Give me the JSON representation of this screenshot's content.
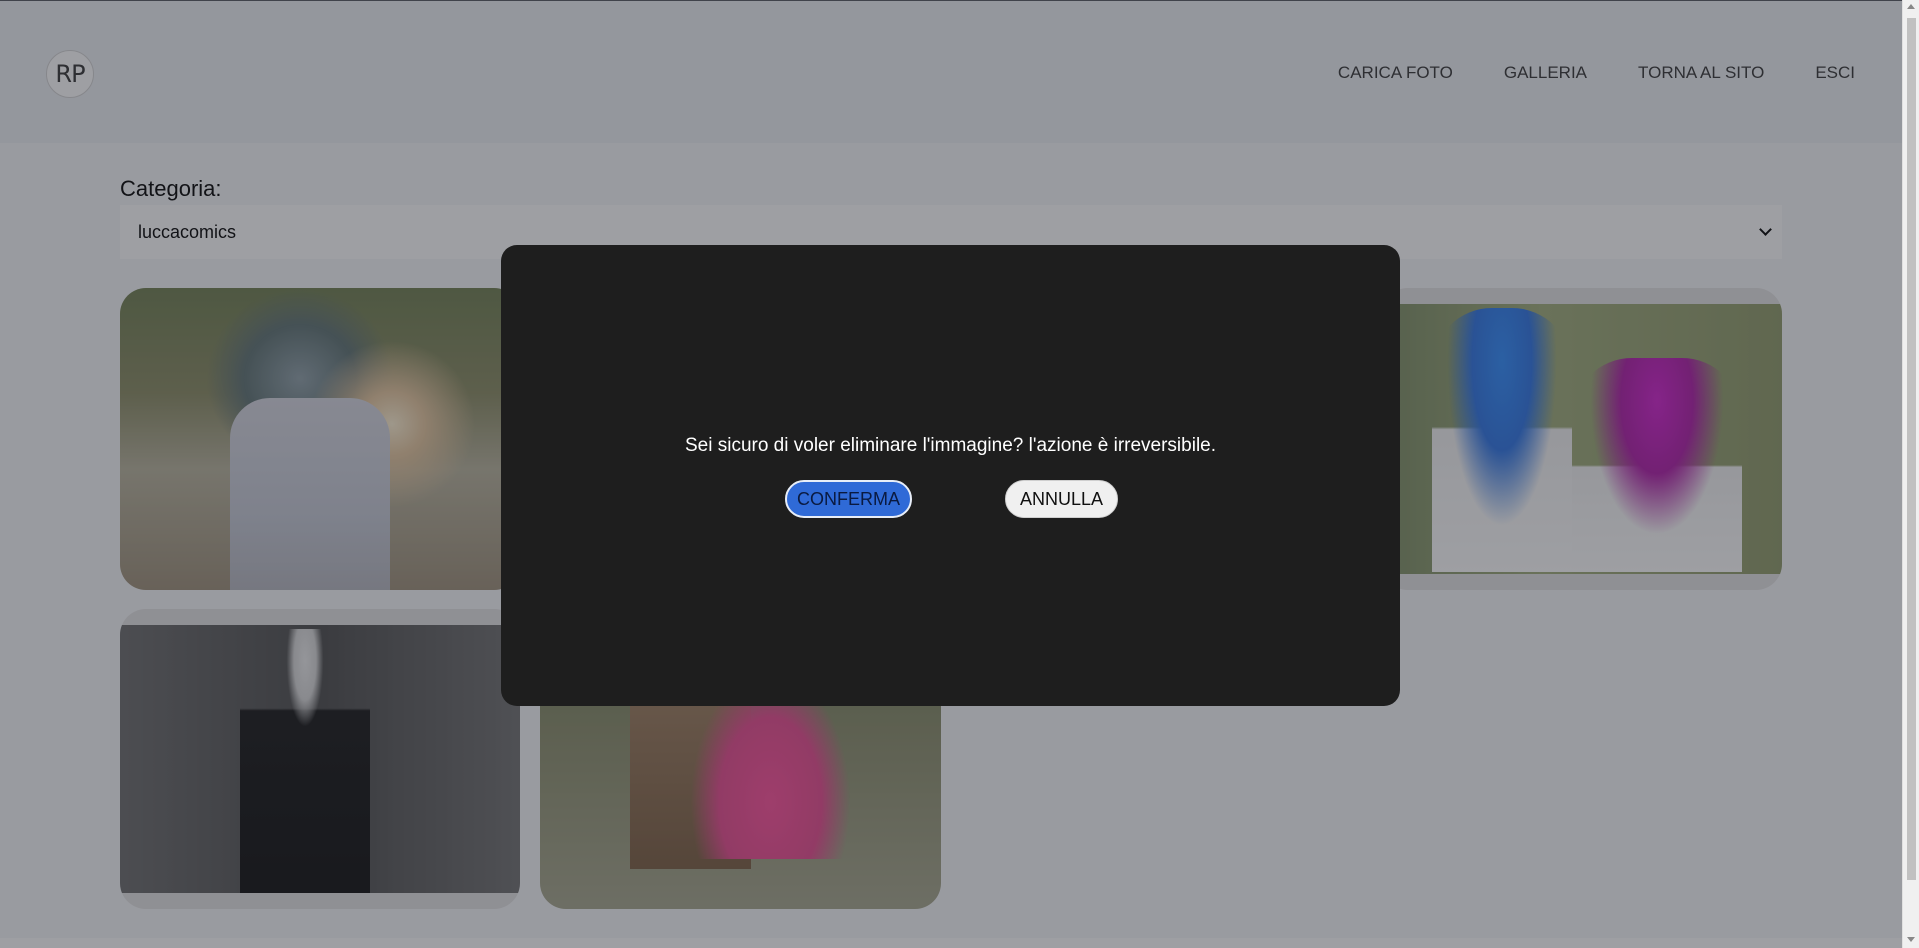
{
  "header": {
    "logo": "RP",
    "nav": [
      "CARICA FOTO",
      "GALLERIA",
      "TORNA AL SITO",
      "ESCI"
    ]
  },
  "filter": {
    "label": "Categoria:",
    "selected": "luccacomics"
  },
  "modal": {
    "message": "Sei sicuro di voler eliminare l'immagine? l'azione è irreversibile.",
    "confirm": "CONFERMA",
    "cancel": "ANNULLA"
  }
}
